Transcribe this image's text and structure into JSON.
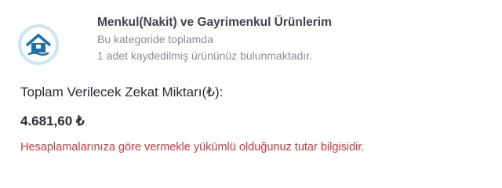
{
  "category": {
    "icon": "home-icon",
    "title": "Menkul(Nakit) ve Gayrimenkul Ürünlerim",
    "line1": "Bu kategoride toplamda",
    "line2": "1 adet kaydedilmiş ürününüz bulunmaktadır."
  },
  "total": {
    "label": "Toplam Verilecek Zekat Miktarı(₺):",
    "value": "4.681,60 ₺"
  },
  "note": "Hesaplamalarınıza göre vermekle yükümlü olduğunuz tutar bilgisidir.",
  "colors": {
    "icon_ring": "#c9e6f5",
    "icon_fill": "#1f6fa8",
    "title": "#3f4350",
    "muted": "#8b8e96",
    "note": "#d9383e"
  }
}
